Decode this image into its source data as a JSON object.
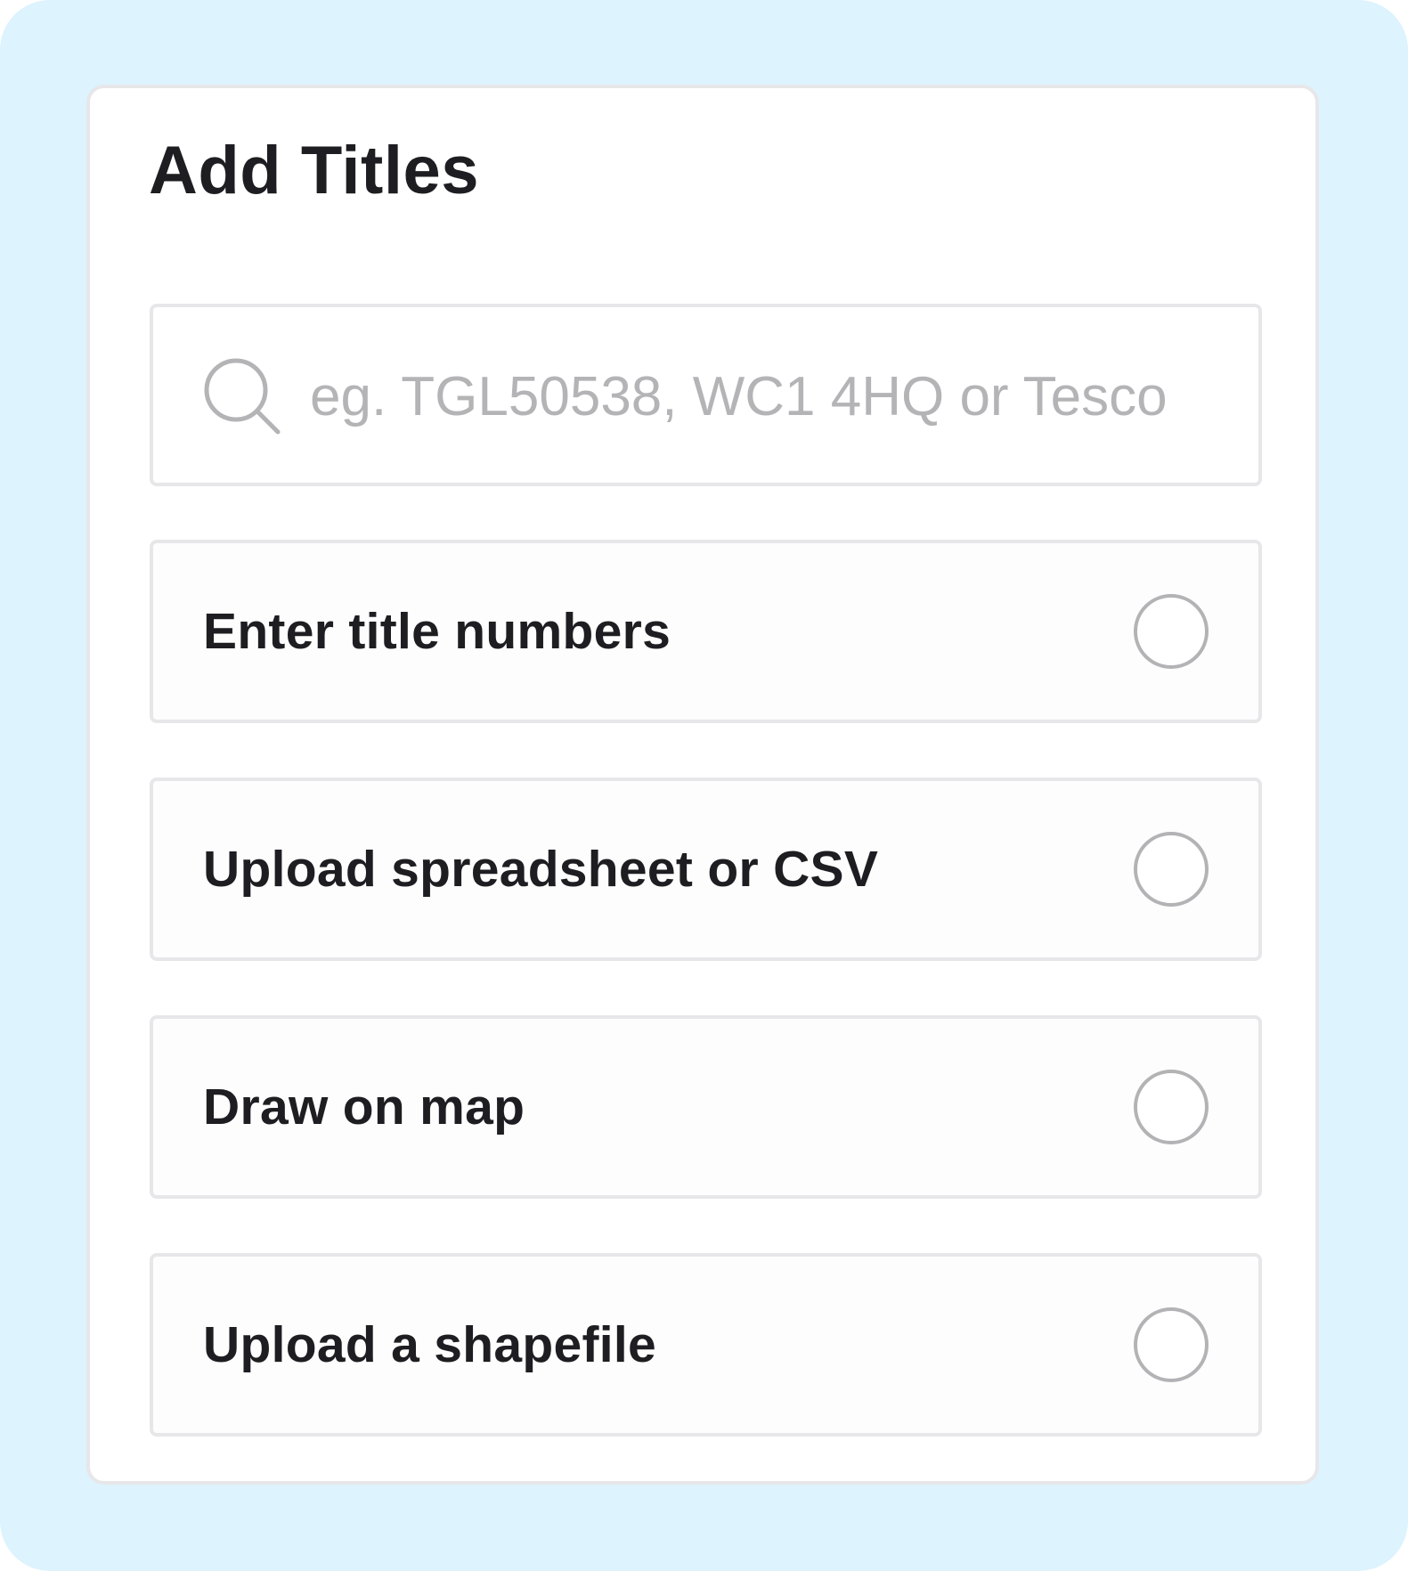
{
  "panel": {
    "title": "Add Titles"
  },
  "search": {
    "placeholder": "eg. TGL50538, WC1 4HQ or Tesco",
    "value": "",
    "icon": "search-icon"
  },
  "options": [
    {
      "label": "Enter title numbers",
      "selected": false
    },
    {
      "label": "Upload spreadsheet or CSV",
      "selected": false
    },
    {
      "label": "Draw on map",
      "selected": false
    },
    {
      "label": "Upload a shapefile",
      "selected": false
    }
  ],
  "colors": {
    "background": "#ddf3fd",
    "card": "#ffffff",
    "border": "#e7e7ea",
    "text": "#1e1e22",
    "placeholder": "#b4b4b7",
    "radio_border": "#b3b3b6"
  }
}
